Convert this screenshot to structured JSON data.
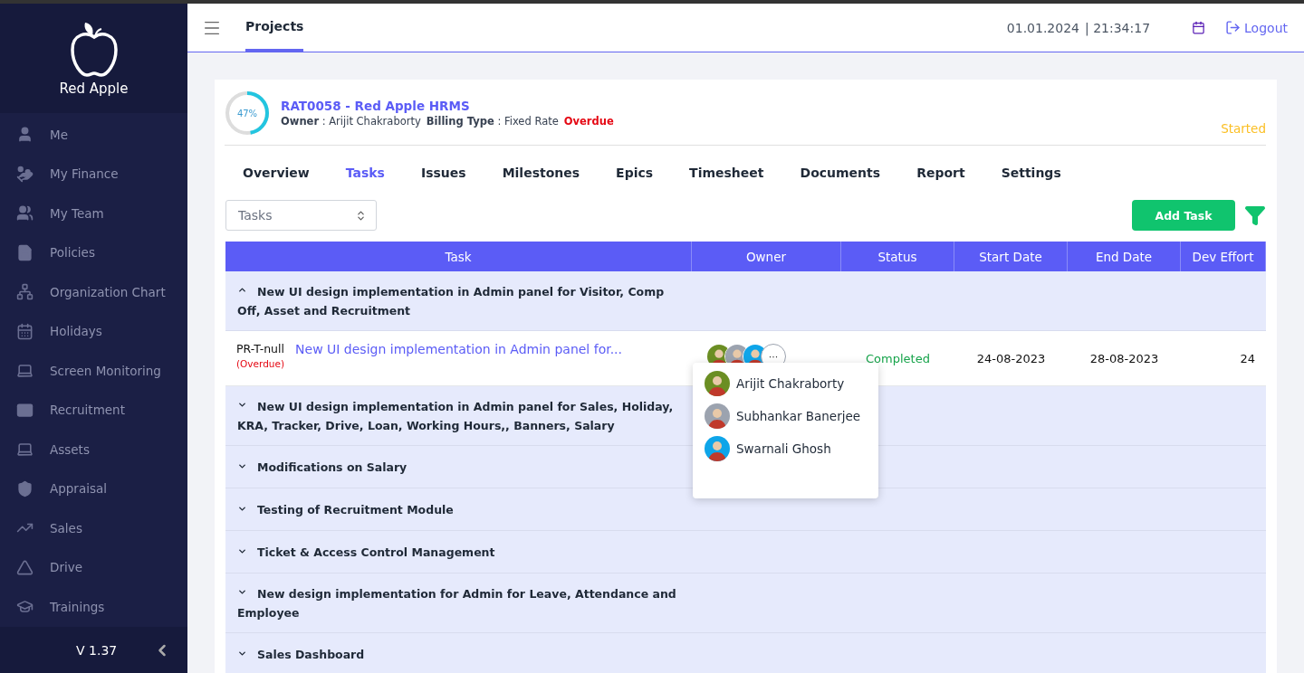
{
  "sidebar": {
    "brand": "Red Apple",
    "items": [
      {
        "label": "Me",
        "selected": false
      },
      {
        "label": "My Finance",
        "selected": false
      },
      {
        "label": "My Team",
        "selected": false
      },
      {
        "label": "Policies",
        "selected": false
      },
      {
        "label": "Organization Chart",
        "selected": false
      },
      {
        "label": "Holidays",
        "selected": false
      },
      {
        "label": "Screen Monitoring",
        "selected": false
      },
      {
        "label": "Recruitment",
        "selected": false
      },
      {
        "label": "Assets",
        "selected": false
      },
      {
        "label": "Appraisal",
        "selected": false
      },
      {
        "label": "Sales",
        "selected": false
      },
      {
        "label": "Drive",
        "selected": false
      },
      {
        "label": "Trainings",
        "selected": false
      }
    ],
    "version": "V 1.37"
  },
  "header": {
    "tab": "Projects",
    "date": "01.01.2024",
    "time": "| 21:34:17",
    "logout": "Logout"
  },
  "project": {
    "progress": {
      "level": 0.47,
      "label": "47%"
    },
    "title": "RAT0058 - Red Apple HRMS",
    "owner_label": "Owner",
    "owner": ": Arijit Chakraborty",
    "billing_label": "Billing Type",
    "billing": ": Fixed Rate",
    "flag": "Overdue",
    "status": "Started"
  },
  "tabs": [
    {
      "label": "Overview",
      "selected": false
    },
    {
      "label": "Tasks",
      "selected": true
    },
    {
      "label": "Issues",
      "selected": false
    },
    {
      "label": "Milestones",
      "selected": false
    },
    {
      "label": "Epics",
      "selected": false
    },
    {
      "label": "Timesheet",
      "selected": false
    },
    {
      "label": "Documents",
      "selected": false
    },
    {
      "label": "Report",
      "selected": false
    },
    {
      "label": "Settings",
      "selected": false
    }
  ],
  "select": {
    "value": "Tasks"
  },
  "add_button": "Add Task",
  "table": {
    "columns": [
      "Task",
      "Owner",
      "Status",
      "Start Date",
      "End Date",
      "Dev Effort"
    ],
    "groups": [
      {
        "title": "New UI design implementation in Admin panel for Visitor, Comp Off, Asset and Recruitment",
        "expanded": true,
        "tasks": [
          {
            "id": "PR-T-null",
            "flag": "(Overdue)",
            "title": "New UI design implementation in Admin panel for...",
            "owners_more": "···",
            "status": "Completed",
            "start": "24-08-2023",
            "end": "28-08-2023",
            "effort": "24"
          }
        ]
      },
      {
        "title": "New UI design implementation in Admin panel for Sales, Holiday, KRA, Tracker, Drive, Loan, Working Hours,, Banners, Salary",
        "expanded": false
      },
      {
        "title": "Modifications on Salary",
        "expanded": false
      },
      {
        "title": "Testing of Recruitment Module",
        "expanded": false
      },
      {
        "title": "Ticket & Access Control Management",
        "expanded": false
      },
      {
        "title": "New design implementation for Admin for Leave, Attendance and Employee",
        "expanded": false
      },
      {
        "title": "Sales Dashboard",
        "expanded": false
      }
    ]
  },
  "owner_popup": [
    "Arijit Chakraborty",
    "Subhankar Banerjee",
    "Swarnali Ghosh"
  ]
}
